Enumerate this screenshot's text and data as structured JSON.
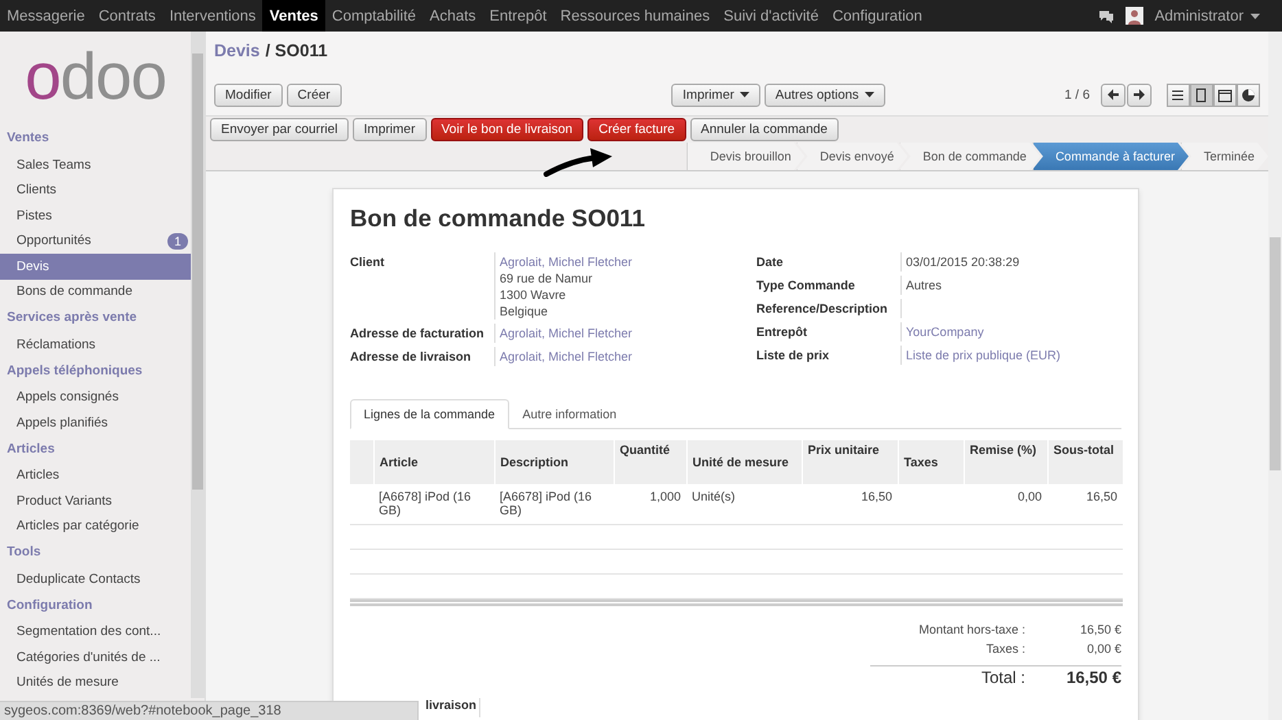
{
  "top_menu": [
    {
      "label": "Messagerie",
      "selected": false
    },
    {
      "label": "Contrats",
      "selected": false
    },
    {
      "label": "Interventions",
      "selected": false
    },
    {
      "label": "Ventes",
      "selected": true
    },
    {
      "label": "Comptabilité",
      "selected": false
    },
    {
      "label": "Achats",
      "selected": false
    },
    {
      "label": "Entrepôt",
      "selected": false
    },
    {
      "label": "Ressources humaines",
      "selected": false
    },
    {
      "label": "Suivi d'activité",
      "selected": false
    },
    {
      "label": "Configuration",
      "selected": false
    }
  ],
  "user": {
    "name": "Administrator"
  },
  "logo": "odoo",
  "sidebar": {
    "sections": [
      {
        "title": "Ventes",
        "items": [
          {
            "label": "Sales Teams",
            "selected": false
          },
          {
            "label": "Clients",
            "selected": false
          },
          {
            "label": "Pistes",
            "selected": false
          },
          {
            "label": "Opportunités",
            "selected": false,
            "badge": "1"
          },
          {
            "label": "Devis",
            "selected": true
          },
          {
            "label": "Bons de commande",
            "selected": false
          }
        ]
      },
      {
        "title": "Services après vente",
        "items": [
          {
            "label": "Réclamations",
            "selected": false
          }
        ]
      },
      {
        "title": "Appels téléphoniques",
        "items": [
          {
            "label": "Appels consignés",
            "selected": false
          },
          {
            "label": "Appels planifiés",
            "selected": false
          }
        ]
      },
      {
        "title": "Articles",
        "items": [
          {
            "label": "Articles",
            "selected": false
          },
          {
            "label": "Product Variants",
            "selected": false
          },
          {
            "label": "Articles par catégorie",
            "selected": false
          }
        ]
      },
      {
        "title": "Tools",
        "items": [
          {
            "label": "Deduplicate Contacts",
            "selected": false
          }
        ]
      },
      {
        "title": "Configuration",
        "items": [
          {
            "label": "Segmentation des cont...",
            "selected": false
          },
          {
            "label": "Catégories d'unités de ...",
            "selected": false
          },
          {
            "label": "Unités de mesure",
            "selected": false
          }
        ]
      }
    ]
  },
  "breadcrumb": {
    "parent": "Devis",
    "current": "/ SO011"
  },
  "toolbar": {
    "left_buttons": [
      "Modifier",
      "Créer"
    ],
    "dropdowns": [
      "Imprimer",
      "Autres options"
    ],
    "pager": "1 / 6"
  },
  "views": [
    {
      "kind": "list",
      "selected": false
    },
    {
      "kind": "form",
      "selected": true
    },
    {
      "kind": "calendar",
      "selected": false
    },
    {
      "kind": "graph",
      "selected": false
    }
  ],
  "actions": [
    {
      "label": "Envoyer par courriel",
      "kind": "default"
    },
    {
      "label": "Imprimer",
      "kind": "default"
    },
    {
      "label": "Voir le bon de livraison",
      "kind": "primary"
    },
    {
      "label": "Créer facture",
      "kind": "primary"
    },
    {
      "label": "Annuler la commande",
      "kind": "default"
    }
  ],
  "stages": [
    {
      "label": "Devis brouillon",
      "selected": false
    },
    {
      "label": "Devis envoyé",
      "selected": false
    },
    {
      "label": "Bon de commande",
      "selected": false
    },
    {
      "label": "Commande à facturer",
      "selected": true
    },
    {
      "label": "Terminée",
      "selected": false
    }
  ],
  "sheet": {
    "title": "Bon de commande SO011",
    "left_fields": [
      {
        "label": "Client",
        "link": "Agrolait, Michel Fletcher",
        "lines": [
          "69 rue de Namur",
          "1300 Wavre",
          "Belgique"
        ]
      },
      {
        "label": "Adresse de facturation",
        "link": "Agrolait, Michel Fletcher"
      },
      {
        "label": "Adresse de livraison",
        "link": "Agrolait, Michel Fletcher"
      }
    ],
    "right_fields": [
      {
        "label": "Date",
        "value": "03/01/2015 20:38:29"
      },
      {
        "label": "Type Commande",
        "value": "Autres"
      },
      {
        "label": "Reference/Description"
      },
      {
        "label": "Entrepôt",
        "link": "YourCompany"
      },
      {
        "label": "Liste de prix",
        "link": "Liste de prix publique (EUR)"
      }
    ],
    "tabs": [
      {
        "label": "Lignes de la commande",
        "selected": true
      },
      {
        "label": "Autre information",
        "selected": false
      }
    ],
    "table": {
      "columns": [
        {
          "label": "Article",
          "numeric": false
        },
        {
          "label": "Description",
          "numeric": false
        },
        {
          "label": "Quantité",
          "numeric": true
        },
        {
          "label": "Unité de mesure",
          "numeric": false
        },
        {
          "label": "Prix unitaire",
          "numeric": true
        },
        {
          "label": "Taxes",
          "numeric": false
        },
        {
          "label": "Remise (%)",
          "numeric": true
        },
        {
          "label": "Sous-total",
          "numeric": true
        }
      ],
      "rows": [
        [
          "[A6678] iPod (16 GB)",
          "[A6678] iPod (16 GB)",
          "1,000",
          "Unité(s)",
          "16,50",
          "",
          "0,00",
          "16,50"
        ]
      ]
    },
    "totals": [
      {
        "label": "Montant hors-taxe :",
        "value": "16,50 €"
      },
      {
        "label": "Taxes :",
        "value": "0,00 €"
      }
    ],
    "total": {
      "label": "Total :",
      "value": "16,50 €"
    },
    "bottom_label": "livraison"
  },
  "status_url": "sygeos.com:8369/web?#notebook_page_318"
}
